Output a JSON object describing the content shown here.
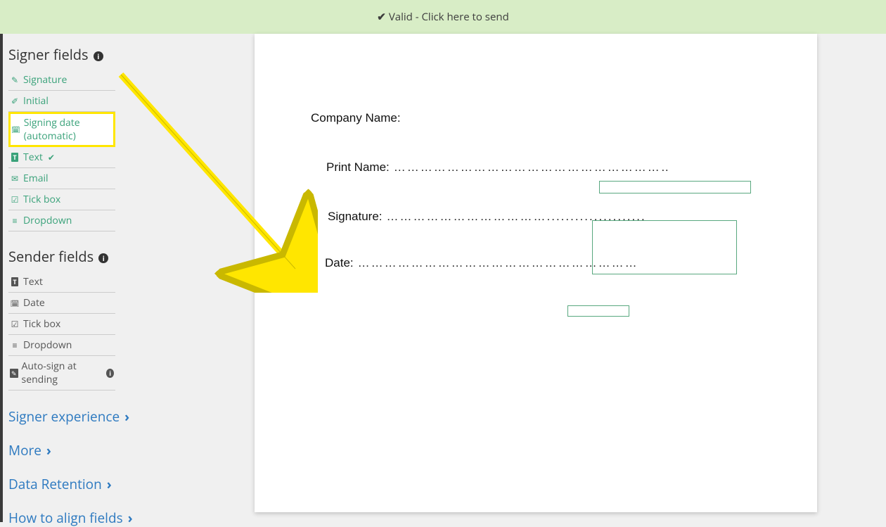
{
  "banner": {
    "text": "Valid - Click here to send"
  },
  "sidebar": {
    "signer_title": "Signer fields",
    "sender_title": "Sender fields",
    "signer_items": [
      {
        "label": "Signature"
      },
      {
        "label": "Initial"
      },
      {
        "label": "Signing date (automatic)"
      },
      {
        "label": "Text"
      },
      {
        "label": "Email"
      },
      {
        "label": "Tick box"
      },
      {
        "label": "Dropdown"
      }
    ],
    "sender_items": [
      {
        "label": "Text"
      },
      {
        "label": "Date"
      },
      {
        "label": "Tick box"
      },
      {
        "label": "Dropdown"
      },
      {
        "label": "Auto-sign at sending"
      }
    ],
    "links": [
      "Signer experience",
      "More",
      "Data Retention",
      "How to align fields"
    ]
  },
  "document": {
    "company_label": "Company Name:",
    "print_label": "Print Name:",
    "signature_label": "Signature:",
    "date_label": "Date:"
  }
}
